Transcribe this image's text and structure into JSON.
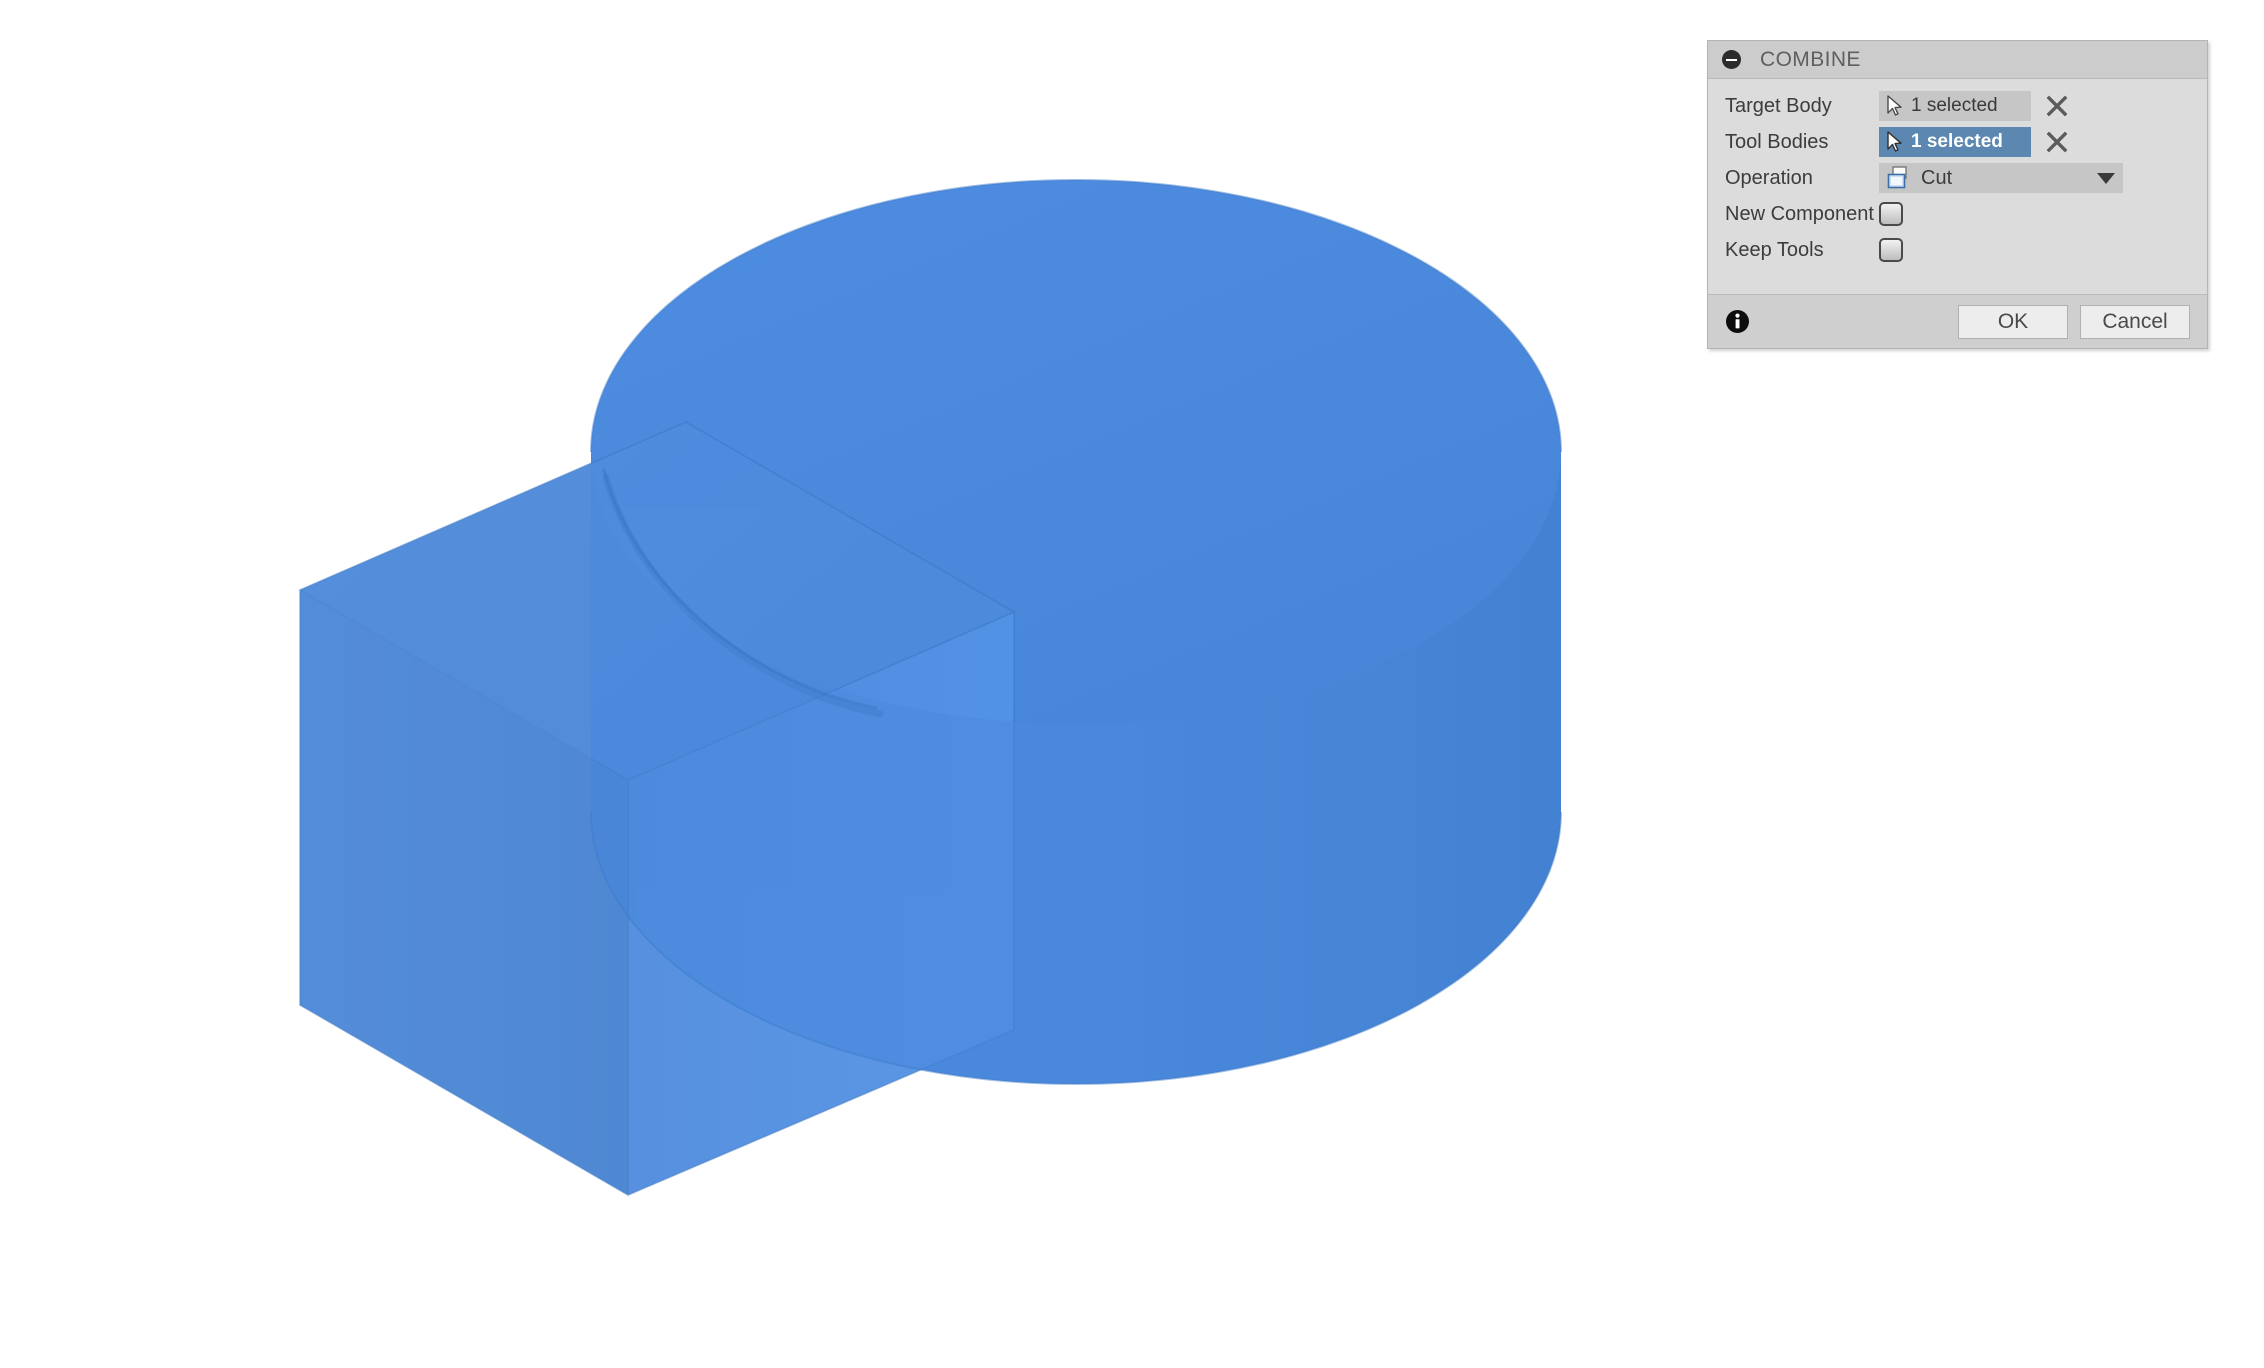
{
  "viewport": {
    "background_color": "#ffffff",
    "model_color": "#4285d8",
    "bodies": [
      {
        "name": "cylinder",
        "role": "target-body"
      },
      {
        "name": "box",
        "role": "tool-body"
      }
    ]
  },
  "panel": {
    "title": "COMBINE",
    "collapse_icon": "minus-circle-icon",
    "rows": [
      {
        "label": "Target Body",
        "type": "selection",
        "value": "1 selected",
        "icon": "cursor-arrow-icon",
        "active": false,
        "clear_icon": "close-x-icon"
      },
      {
        "label": "Tool Bodies",
        "type": "selection",
        "value": "1 selected",
        "icon": "cursor-arrow-icon",
        "active": true,
        "clear_icon": "close-x-icon"
      },
      {
        "label": "Operation",
        "type": "dropdown",
        "value": "Cut",
        "icon": "cut-operation-icon",
        "caret_icon": "chevron-down-icon"
      },
      {
        "label": "New Component",
        "type": "checkbox",
        "checked": false
      },
      {
        "label": "Keep Tools",
        "type": "checkbox",
        "checked": false
      }
    ],
    "footer": {
      "info_icon": "info-circle-icon",
      "ok_label": "OK",
      "cancel_label": "Cancel"
    },
    "colors": {
      "accent_blue": "#5b87b0",
      "panel_bg": "#dcdcdc",
      "header_bg": "#cccccc",
      "footer_bg": "#cfcfcf",
      "field_bg": "#c6c6c6"
    }
  }
}
